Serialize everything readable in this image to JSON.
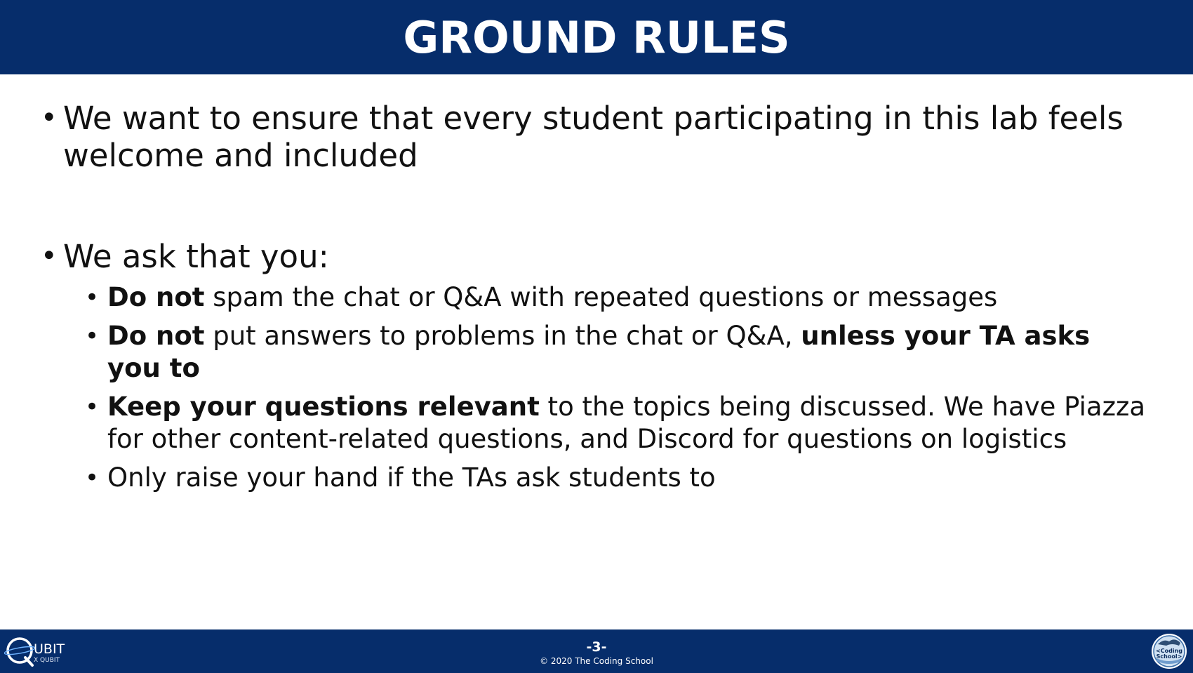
{
  "slide": {
    "title": "GROUND RULES",
    "bullets": [
      {
        "text": "We want to ensure that every student participating in this lab feels welcome and included"
      },
      {
        "text": "We ask that you:",
        "sub": [
          {
            "bold1": "Do not",
            "rest": " spam the chat or Q&A with repeated questions or messages"
          },
          {
            "bold1": "Do not",
            "rest": " put answers to problems in the chat or Q&A, ",
            "bold2": "unless your TA asks you to"
          },
          {
            "bold1": "Keep your questions relevant",
            "rest": " to the topics being discussed. We have Piazza for other content-related questions, and Discord for questions on logistics"
          },
          {
            "rest": "Only raise your hand if the TAs ask students to"
          }
        ]
      }
    ]
  },
  "footer": {
    "page_number": "-3-",
    "copyright": "© 2020 The Coding School",
    "logo_left_text": "UBIT",
    "logo_left_subtext": "X QUBIT",
    "logo_right_text_1": "<Coding",
    "logo_right_text_2": "School>"
  },
  "colors": {
    "brand_navy": "#062d6b",
    "text": "#111111",
    "background": "#ffffff"
  },
  "icons": [
    "qubit-logo-icon",
    "coding-school-logo-icon"
  ]
}
